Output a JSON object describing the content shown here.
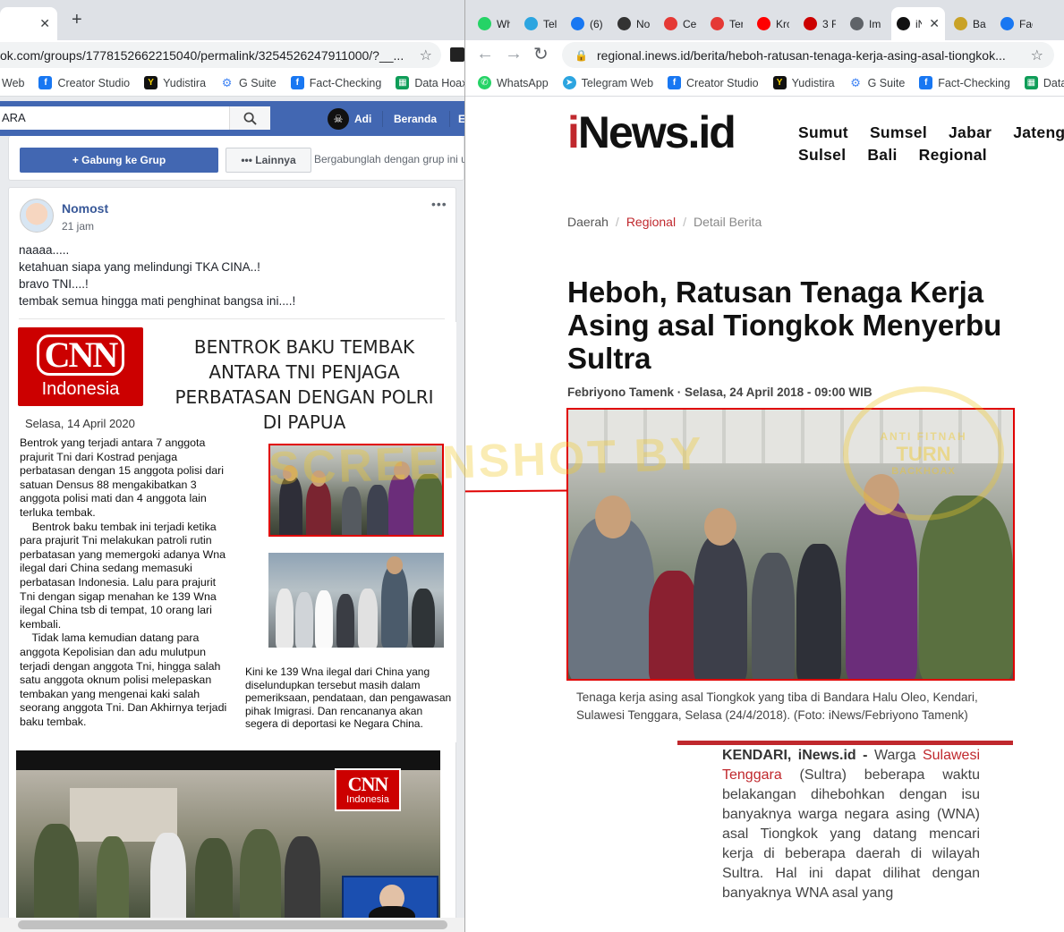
{
  "left_window": {
    "tab_close": "✕",
    "new_tab": "+",
    "url": "ok.com/groups/1778152662215040/permalink/3254526247911000/?__...",
    "bookmarks": [
      {
        "label": "Web",
        "icon": "globe-icon"
      },
      {
        "label": "Creator Studio",
        "icon": "facebook-icon"
      },
      {
        "label": "Yudistira",
        "icon": "yudistira-icon"
      },
      {
        "label": "G Suite",
        "icon": "gear-icon"
      },
      {
        "label": "Fact-Checking",
        "icon": "facebook-icon"
      },
      {
        "label": "Data Hoax",
        "icon": "sheets-icon"
      }
    ],
    "fb": {
      "search_value": "ARA",
      "user_name": "Adi",
      "nav_home": "Beranda",
      "nav_more": "E",
      "join_button": "+ Gabung ke Grup",
      "more_button": "••• Lainnya",
      "join_hint": "Bergabunglah dengan grup ini u",
      "post": {
        "author": "Nomost",
        "time": "21 jam",
        "menu": "•••",
        "lines": [
          "naaaa.....",
          "ketahuan siapa yang melindungi TKA CINA..!",
          "bravo TNI....!",
          "tembak semua hingga mati penghinat bangsa ini....!"
        ]
      },
      "clipping": {
        "logo_top": "CNN",
        "logo_bottom": "Indonesia",
        "headline_lines": [
          "BENTROK  BAKU TEMBAK",
          "ANTARA TNI PENJAGA",
          "PERBATASAN DENGAN POLRI",
          "DI PAPUA"
        ],
        "date": "Selasa, 14 April 2020",
        "body_lines": [
          "Bentrok yang terjadi antara 7 anggota",
          "prajurit Tni dari Kostrad penjaga",
          "perbatasan dengan 15 anggota polisi dari",
          "satuan Densus 88 mengakibatkan 3",
          "anggota polisi mati dan 4 anggota lain",
          "terluka tembak.",
          "    Bentrok baku tembak ini terjadi ketika",
          "para prajurit Tni melakukan patroli rutin",
          "perbatasan yang memergoki adanya Wna",
          "ilegal dari China sedang memasuki",
          "perbatasan Indonesia. Lalu para prajurit",
          "Tni dengan sigap menahan ke 139 Wna",
          "ilegal China tsb di tempat, 10 orang lari",
          "kembali.",
          "    Tidak lama kemudian datang para",
          "anggota Kepolisian dan adu mulutpun",
          "terjadi dengan anggota Tni, hingga salah",
          "satu anggota oknum polisi melepaskan",
          "tembakan yang mengenai kaki salah",
          "seorang anggota Tni. Dan Akhirnya terjadi",
          "baku tembak."
        ],
        "photo_caption_lines": [
          "Kini ke 139 Wna ilegal dari China yang",
          "diselundupkan tersebut masih dalam",
          "pemeriksaan, pendataan, dan pengawasan",
          "pihak Imigrasi. Dan rencananya akan",
          "segera di deportasi ke Negara China."
        ]
      },
      "video_logo_top": "CNN",
      "video_logo_bottom": "Indonesia"
    }
  },
  "right_window": {
    "tabs": [
      {
        "label": "Wh",
        "icon": "whatsapp-icon",
        "color": "#25d366"
      },
      {
        "label": "Tel",
        "icon": "telegram-icon",
        "color": "#2ca5e0"
      },
      {
        "label": "(6)",
        "icon": "facebook-icon",
        "color": "#1877f2"
      },
      {
        "label": "No",
        "icon": "bike-icon",
        "color": "#333333"
      },
      {
        "label": "Cel",
        "icon": "t-icon",
        "color": "#e53935"
      },
      {
        "label": "Ter",
        "icon": "t-icon",
        "color": "#e53935"
      },
      {
        "label": "Krc",
        "icon": "youtube-icon",
        "color": "#ff0000"
      },
      {
        "label": "3 F",
        "icon": "cnn-icon",
        "color": "#cc0000"
      },
      {
        "label": "Im",
        "icon": "globe-icon",
        "color": "#5f6368"
      },
      {
        "label": "iN",
        "icon": "inews-icon",
        "color": "#111111",
        "active": true
      },
      {
        "label": "Bal",
        "icon": "medal-icon",
        "color": "#c9a227"
      },
      {
        "label": "Fac",
        "icon": "facebook-icon",
        "color": "#1877f2"
      }
    ],
    "tab_close": "✕",
    "url": "regional.inews.id/berita/heboh-ratusan-tenaga-kerja-asing-asal-tiongkok...",
    "bookmarks": [
      {
        "label": "WhatsApp",
        "icon": "whatsapp-icon"
      },
      {
        "label": "Telegram Web",
        "icon": "telegram-icon"
      },
      {
        "label": "Creator Studio",
        "icon": "facebook-icon"
      },
      {
        "label": "Yudistira",
        "icon": "yudistira-icon"
      },
      {
        "label": "G Suite",
        "icon": "gear-icon"
      },
      {
        "label": "Fact-Checking",
        "icon": "facebook-icon"
      },
      {
        "label": "Data",
        "icon": "sheets-icon"
      }
    ],
    "inews": {
      "logo_i": "i",
      "logo_rest": "News.id",
      "nav_row1": [
        "Sumut",
        "Sumsel",
        "Jabar",
        "Jateng"
      ],
      "nav_row2": [
        "Sulsel",
        "Bali",
        "Regional"
      ],
      "breadcrumb": [
        "Daerah",
        "Regional",
        "Detail Berita"
      ],
      "headline": "Heboh, Ratusan Tenaga Kerja Asing asal Tiongkok Menyerbu Sultra",
      "byline": "Febriyono Tamenk · Selasa, 24 April 2018 - 09:00 WIB",
      "caption": "Tenaga kerja asing asal Tiongkok yang tiba di Bandara Halu Oleo, Kendari, Sulawesi Tenggara, Selasa (24/4/2018). (Foto: iNews/Febriyono Tamenk)",
      "dateline": "KENDARI, iNews.id -",
      "body_pre": " Warga ",
      "body_link": "Sulawesi Tenggara",
      "body_post": " (Sultra) beberapa waktu belakangan dihebohkan dengan isu banyaknya warga negara asing (WNA) asal Tiongkok yang datang mencari kerja di beberapa daerah di wilayah Sultra. Hal ini dapat dilihat dengan banyaknya WNA asal yang"
    }
  },
  "watermark": {
    "text": "SCREENSHOT BY",
    "seal_top": "ANTI FITNAH",
    "seal_mid": "TURN",
    "seal_bottom": "BACKHOAX"
  },
  "colors": {
    "fb_blue": "#4267b2",
    "highlight_red": "#e00000",
    "inews_red": "#c0282d",
    "link_red": "#c0282d"
  }
}
